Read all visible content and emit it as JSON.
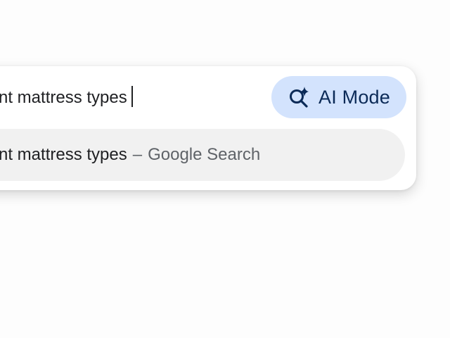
{
  "omnibox": {
    "query_text": "nt mattress types",
    "ai_mode_button": {
      "label": "AI Mode",
      "icon": "search-sparkle-icon",
      "background": "#d3e3fd",
      "text_color": "#0b2a57"
    }
  },
  "suggestion": {
    "query": "nt mattress types",
    "separator": "–",
    "source": "Google Search",
    "background": "#f1f1f1"
  }
}
